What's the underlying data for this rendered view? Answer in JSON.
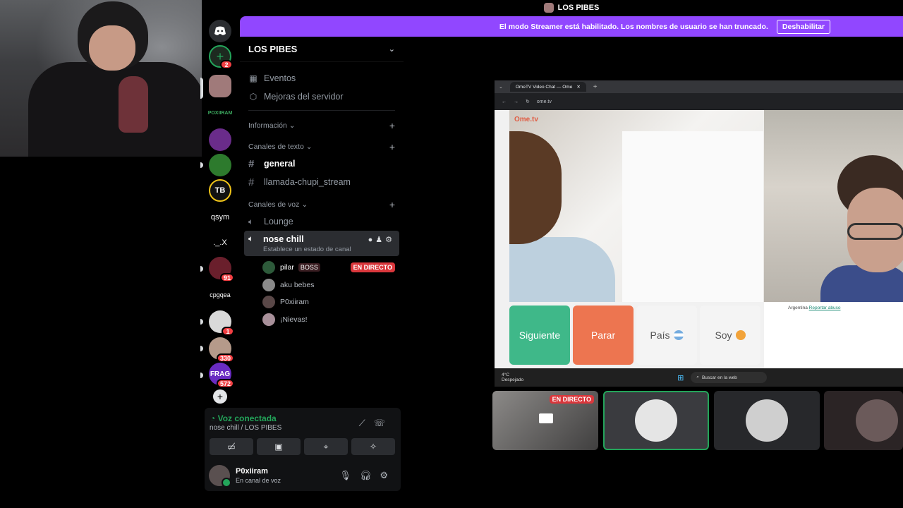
{
  "topbar": {
    "server_name": "LOS PIBES"
  },
  "banner": {
    "text": "El modo Streamer está habilitado. Los nombres de usuario se han truncado.",
    "button": "Deshabilitar"
  },
  "rail": {
    "servers": [
      {
        "name": "discord-home",
        "label": "",
        "badge": ""
      },
      {
        "name": "add-server",
        "label": "",
        "badge": "2"
      },
      {
        "name": "server-los-pibes",
        "label": "",
        "badge": ""
      },
      {
        "name": "server-poxiiram",
        "label": "POXIIRAM",
        "badge": ""
      },
      {
        "name": "server-purple",
        "label": "",
        "badge": ""
      },
      {
        "name": "server-green",
        "label": "",
        "badge": ""
      },
      {
        "name": "server-tb",
        "label": "",
        "badge": ""
      },
      {
        "name": "server-qsym",
        "label": "qsym",
        "badge": ""
      },
      {
        "name": "server-x",
        "label": "._.X",
        "badge": ""
      },
      {
        "name": "server-91",
        "label": "",
        "badge": "91"
      },
      {
        "name": "server-cpgqea",
        "label": "cpgqea",
        "badge": ""
      },
      {
        "name": "server-bw",
        "label": "",
        "badge": "1"
      },
      {
        "name": "server-330",
        "label": "",
        "badge": "330"
      },
      {
        "name": "server-frag",
        "label": "FRAG",
        "badge": "572"
      }
    ]
  },
  "panel": {
    "server_title": "LOS PIBES",
    "events": "Eventos",
    "boosts": "Mejoras del servidor",
    "cat_info": "Información",
    "cat_text": "Canales de texto",
    "text_channels": [
      "general",
      "llamada-chupi_stream"
    ],
    "cat_voice": "Canales de voz",
    "voice_lounge": "Lounge",
    "voice_active": {
      "name": "nose chill",
      "status": "Establece un estado de canal"
    },
    "members": [
      {
        "name": "pilar",
        "tag": "BOSS",
        "live": "EN DIRECTO"
      },
      {
        "name": "aku bebes",
        "tag": "",
        "live": ""
      },
      {
        "name": "P0xiiram",
        "tag": "",
        "live": ""
      },
      {
        "name": "¡Nievas!",
        "tag": "",
        "live": ""
      }
    ]
  },
  "voice": {
    "title": "Voz conectada",
    "location": "nose chill / LOS PIBES"
  },
  "user": {
    "name": "P0xiiram",
    "status": "En canal de voz"
  },
  "stream": {
    "tab_title": "OmeTV Video Chat — Ome",
    "url": "ome.tv",
    "logo": "Ome.tv",
    "btn_next": "Siguiente",
    "btn_stop": "Parar",
    "btn_country": "País",
    "btn_me": "Soy",
    "chat_country": "Argentina",
    "chat_report": "Reportar abuso",
    "weather_temp": "4°C",
    "weather_desc": "Despejado",
    "search": "Buscar en la web"
  },
  "tiles": {
    "live": "EN DIRECTO"
  },
  "colors": {
    "accent": "#9147ff",
    "green": "#23a55a",
    "red": "#da373c",
    "next": "#3fb889",
    "stop": "#ed7550"
  }
}
